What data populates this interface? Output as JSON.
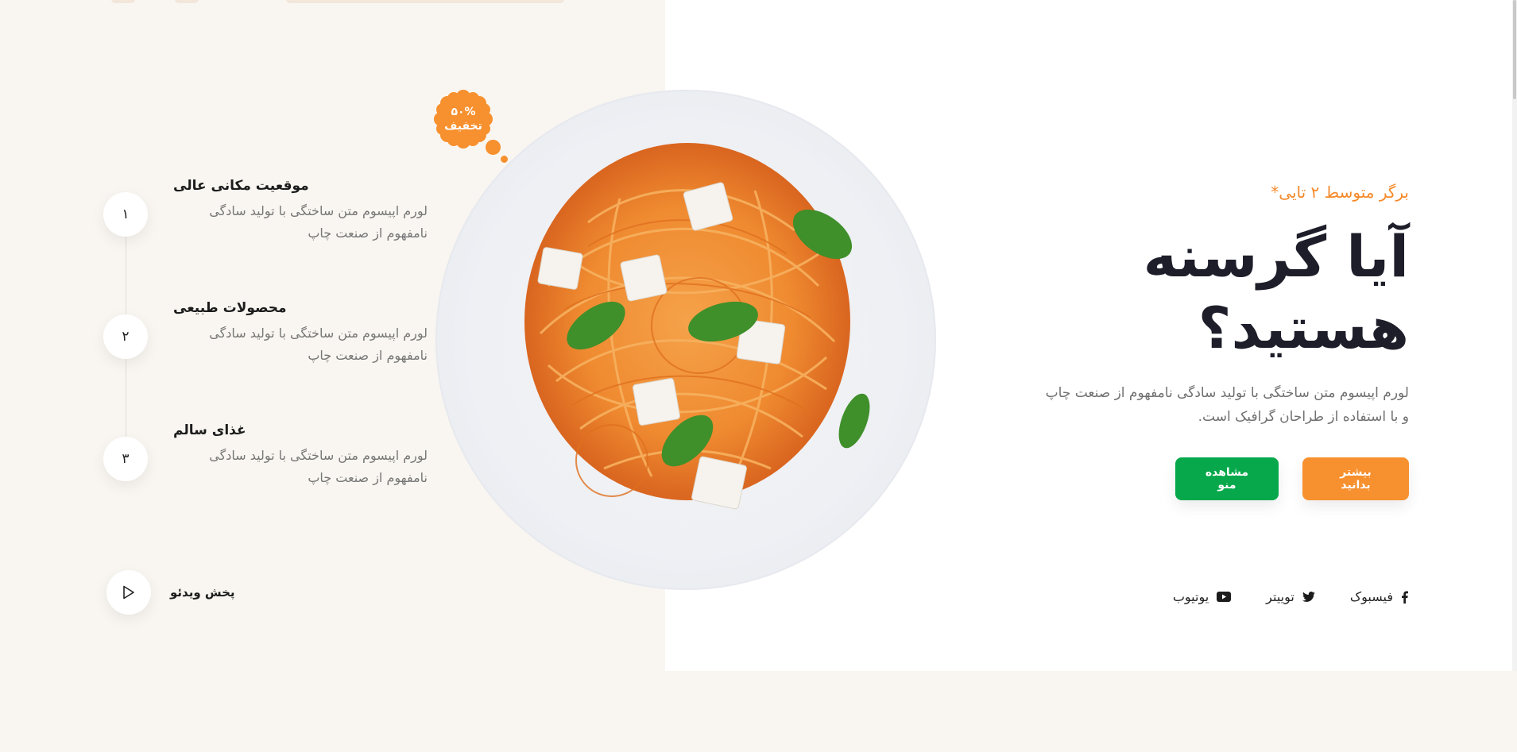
{
  "hero": {
    "tagline": "برگر متوسط ۲ تایی*",
    "headline_line1": "آیا گرسنه",
    "headline_line2": "هستید؟",
    "description_line1": "لورم اپیسوم متن ساختگی با تولید سادگی نامفهوم از صنعت چاپ",
    "description_line2": "و با استفاده از طراحان گرافیک است."
  },
  "buttons": {
    "learn_more": "بیشتر بدانید",
    "view_menu": "مشاهده منو"
  },
  "socials": [
    {
      "label": "فیسبوک",
      "icon": "facebook-icon"
    },
    {
      "label": "توییتر",
      "icon": "twitter-icon"
    },
    {
      "label": "یوتیوب",
      "icon": "youtube-icon"
    }
  ],
  "badge": {
    "percent": "۵۰%",
    "label": "تخفیف"
  },
  "features": [
    {
      "number": "۱",
      "title": "موقعیت مکانی عالی",
      "desc_line1": "لورم اپیسوم متن ساختگی با تولید سادگی",
      "desc_line2": "نامفهوم از صنعت چاپ"
    },
    {
      "number": "۲",
      "title": "محصولات طبیعی",
      "desc_line1": "لورم اپیسوم متن ساختگی با تولید سادگی",
      "desc_line2": "نامفهوم از صنعت چاپ"
    },
    {
      "number": "۳",
      "title": "غذای سالم",
      "desc_line1": "لورم اپیسوم متن ساختگی با تولید سادگی",
      "desc_line2": "نامفهوم از صنعت چاپ"
    }
  ],
  "video": {
    "label": "پخش ویدئو",
    "icon": "play-icon"
  },
  "colors": {
    "accent_orange": "#f7902e",
    "accent_green": "#06a84b",
    "heading": "#1d1e2a",
    "page_bg": "#f9f6f1"
  }
}
